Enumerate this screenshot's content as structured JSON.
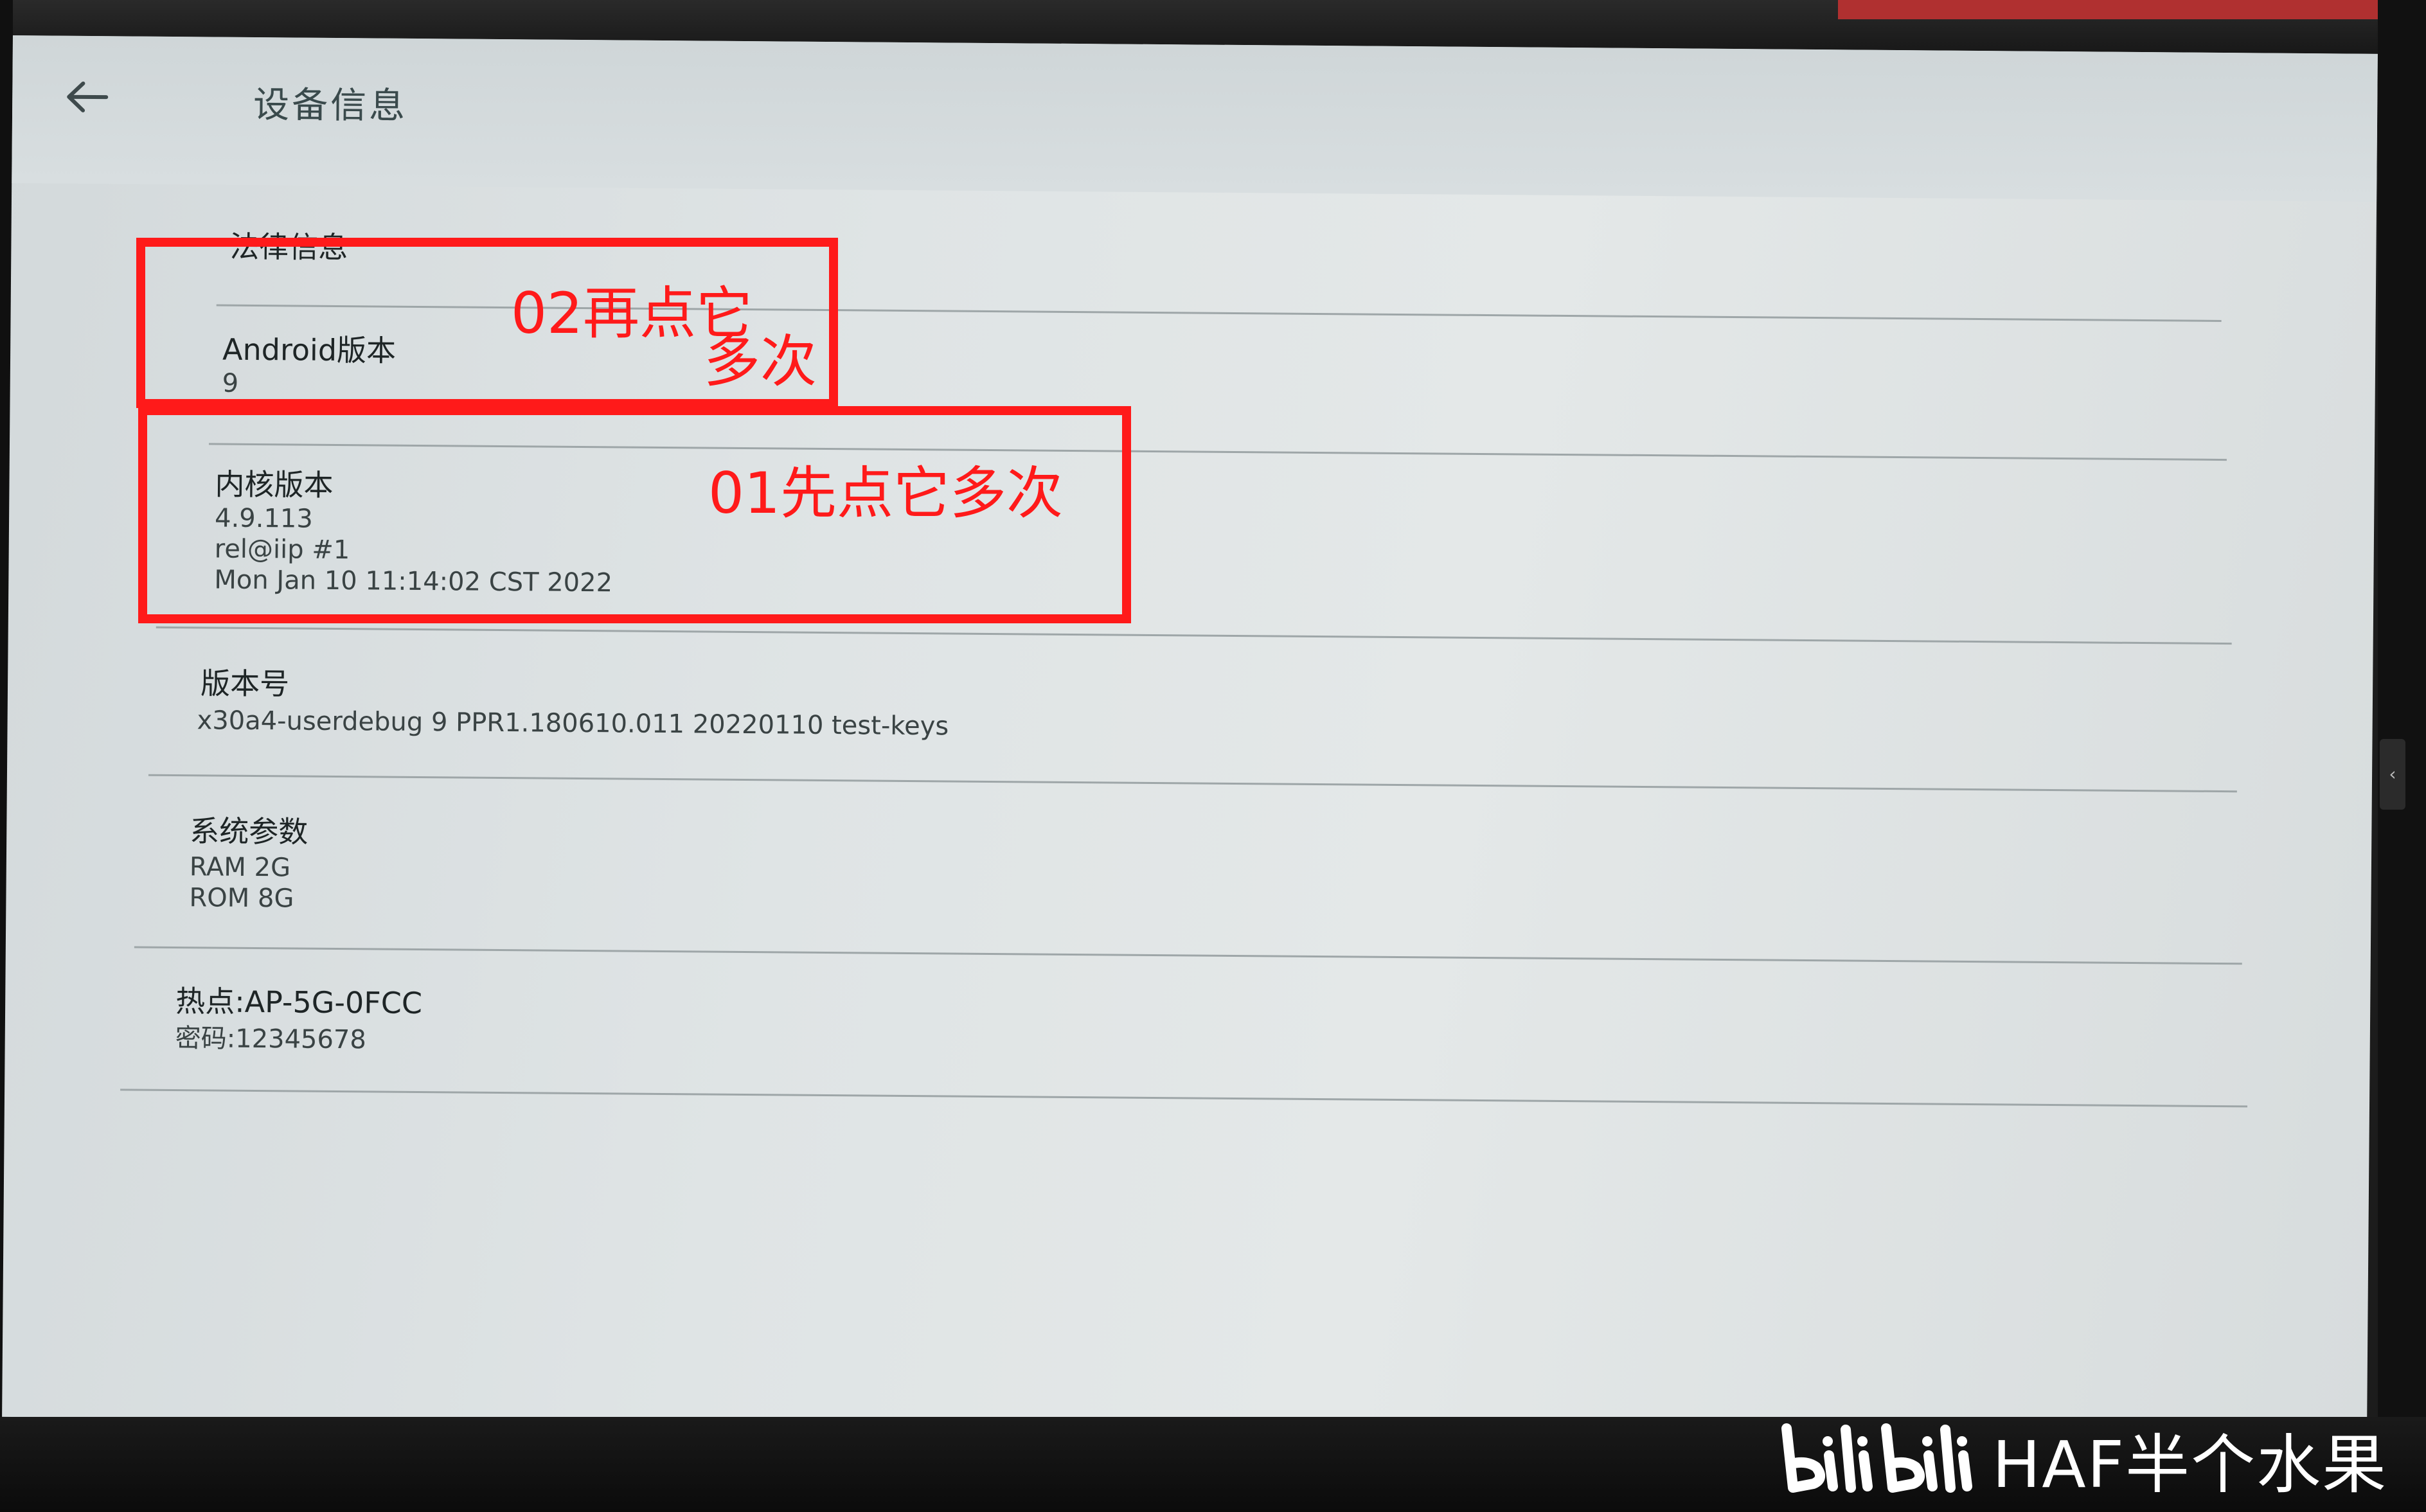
{
  "window": {
    "title": "设备信息"
  },
  "items": [
    {
      "label": "法律信息",
      "values": []
    },
    {
      "label": "Android版本",
      "values": [
        "9"
      ]
    },
    {
      "label": "内核版本",
      "values": [
        "4.9.113",
        "rel@iip #1",
        "Mon Jan 10 11:14:02 CST 2022"
      ]
    },
    {
      "label": "版本号",
      "values": [
        "x30a4-userdebug 9 PPR1.180610.011 20220110 test-keys"
      ]
    },
    {
      "label": "系统参数",
      "values": [
        "RAM  2G",
        "ROM  8G"
      ]
    },
    {
      "label": "热点:AP-5G-0FCC",
      "values": [
        "密码:12345678"
      ]
    }
  ],
  "annotations": {
    "step2": "02再点它",
    "step2_cont": "多次",
    "step1": "01先点它多次",
    "color": "#ff1a1a"
  },
  "watermark": {
    "logo": "bilibili",
    "text": "HAF半个水果"
  },
  "icons": {
    "back": "arrow-left-icon"
  }
}
